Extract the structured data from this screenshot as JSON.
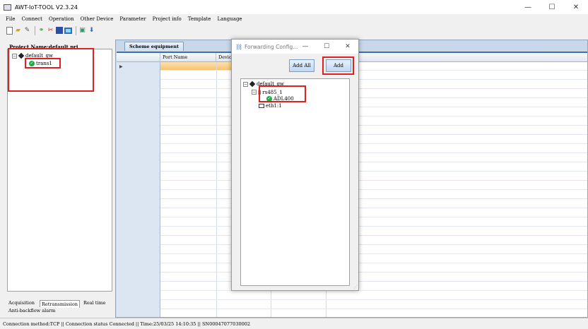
{
  "window": {
    "title": "AWT-IoT-TOOL V2.3.24",
    "controls": [
      "—",
      "☐",
      "✕"
    ]
  },
  "menu": [
    "File",
    "Connect",
    "Operation",
    "Other Device",
    "Parameter",
    "Project info",
    "Template",
    "Language"
  ],
  "toolbar": [
    "new-file-icon",
    "open-folder-icon",
    "edit-icon",
    "connect-icon",
    "disconnect-icon",
    "save-icon",
    "monitor-icon",
    "export-icon",
    "download-icon"
  ],
  "left_panel": {
    "title": "Project Name:default pri",
    "tree": {
      "root": "default_gw",
      "child": "trans1"
    },
    "tabs": [
      "Acquisition",
      "Retransmission",
      "Real time",
      "Anti-backflow alarm"
    ]
  },
  "main": {
    "tab": "Scheme equipment",
    "columns": [
      "Port Name",
      "Devic"
    ]
  },
  "status_bar": "Connection method:TCP || Connection status Connected || Time:25/03/25 14:10:35 || SN00047077030002",
  "dialog": {
    "title": "Forwarding Config...",
    "controls": [
      "—",
      "☐",
      "✕"
    ],
    "add_all_label": "Add All",
    "add_label": "Add",
    "tree": {
      "root": "default_gw",
      "port": "rs485_1",
      "device": "ADL400",
      "eth": "eth1:1"
    }
  },
  "colors": {
    "highlight": "#e02020",
    "ok": "#27a844",
    "selected_row": "#f7c270"
  }
}
